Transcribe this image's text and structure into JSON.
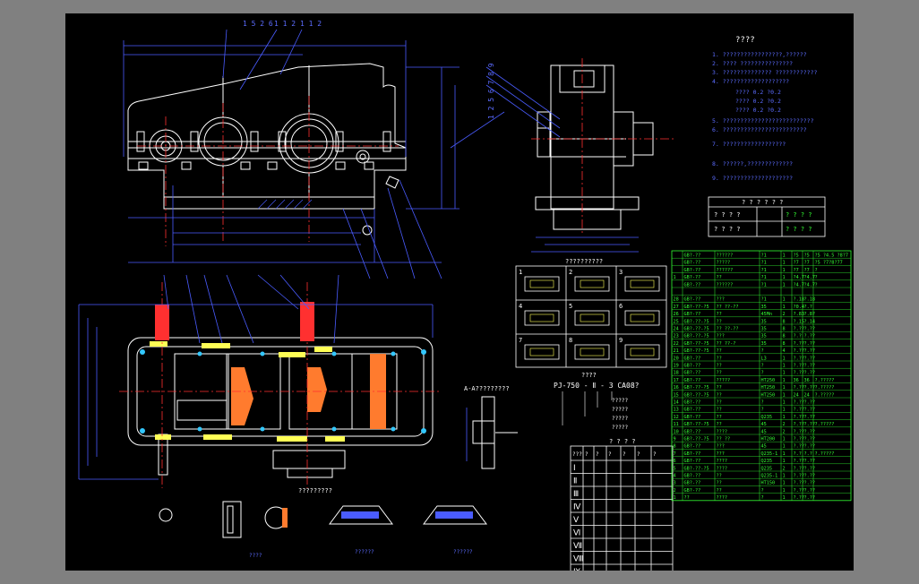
{
  "colors": {
    "background": "#808080",
    "sheet": "#000000",
    "line": "#ffffff",
    "dimension": "#4a5cff",
    "centerline": "#ff3030",
    "table": "#33ff33",
    "callout": "#5c6cff",
    "accent": "#ffff55"
  },
  "top_view_callouts": [
    "1 5 2 6",
    "1 1 2",
    "1 1 2"
  ],
  "side_callouts_vertical": "1 2 5 6 7 8 9",
  "tech_req": {
    "title": "????",
    "lines": [
      "1. ?????????????????,??????",
      "2. ???? ???????????????",
      "3. ?????????????? ????????????",
      "4. ???????????????????",
      "???? 0.2 ?0.2",
      "???? 0.2 ?0.2",
      "???? 0.2 ?0.2",
      "5. ??????????????????????????",
      "6. ????????????????????????",
      "7. ??????????????????",
      "8. ??????,?????????????",
      "9. ????????????????????"
    ]
  },
  "small_table": {
    "header": "? ? ? ? ? ?",
    "rows": [
      [
        "? ? ? ?",
        "",
        "? ? ? ?"
      ],
      [
        "? ? ? ?",
        "",
        "? ? ? ?"
      ]
    ]
  },
  "detail_grid": {
    "title": "??????????",
    "cells": [
      "1",
      "2",
      "3",
      "4",
      "5",
      "6",
      "7",
      "8",
      "9"
    ]
  },
  "model_code": {
    "caption": "????",
    "code": "PJ-750 - Ⅱ - 3 CA08?",
    "notes": [
      "?????",
      "?????",
      "?????",
      "?????"
    ]
  },
  "section_label": "A-A?????????",
  "bottom_labels": [
    "?????????",
    "????",
    "??????",
    "??????"
  ],
  "gear_table": {
    "title": "? ? ? ?",
    "roman": [
      "Ⅰ",
      "Ⅱ",
      "Ⅲ",
      "Ⅳ",
      "Ⅴ",
      "Ⅵ",
      "Ⅶ",
      "Ⅷ",
      "Ⅸ"
    ],
    "header": [
      "???",
      "?",
      "?",
      "?",
      "?",
      "?",
      "?"
    ]
  },
  "parts_list": {
    "rows": [
      [
        "",
        "GB?-??",
        "??????",
        "?1",
        "1",
        "?5",
        "?5",
        "?5 ?4.5 ?8?7"
      ],
      [
        "",
        "GB?-??",
        "?????",
        "?1",
        "1",
        "?7",
        "?7",
        "?5 ?7?8?77"
      ],
      [
        "",
        "GB?-??",
        "??????",
        "?1",
        "1",
        "?7",
        "?7",
        "?"
      ],
      [
        "1",
        "GB?-??",
        "??",
        "?1",
        "1",
        "?4.7",
        "?4.7",
        "?"
      ],
      [
        "",
        "GB?-??",
        "??????",
        "?1",
        "1",
        "?4.7",
        "?4.7",
        "?"
      ],
      [
        "",
        "",
        "",
        "",
        "",
        "",
        "",
        ""
      ],
      [
        "28",
        "GB?-??",
        "???",
        "?1",
        "1",
        "?.18",
        "?.18",
        ""
      ],
      [
        "27",
        "GB?-??-?5",
        "?? ??-??",
        "35",
        "1",
        "?0.4",
        "?.?",
        ""
      ],
      [
        "26",
        "GB?-??",
        "??",
        "45Mn",
        "2",
        "?.83",
        "?.8?",
        ""
      ],
      [
        "25",
        "GB?-??-?5",
        "??",
        "35",
        "8",
        "?.15",
        "?.14",
        ""
      ],
      [
        "24",
        "GB?-??-?5",
        "?? ??-??",
        "35",
        "8",
        "?.??",
        "?.??",
        ""
      ],
      [
        "23",
        "GB?-??-?5",
        "???",
        "35",
        "8",
        "?.?",
        "?.??",
        ""
      ],
      [
        "22",
        "GB?-??-?5",
        "?? ??-?",
        "35",
        "8",
        "?.??",
        "?.??",
        ""
      ],
      [
        "21",
        "GB?-??-?5",
        "??",
        "?",
        "4",
        "?.??",
        "?.??",
        ""
      ],
      [
        "20",
        "GB?-??",
        "??",
        "L3",
        "1",
        "?.??",
        "?.??",
        ""
      ],
      [
        "19",
        "GB?-??",
        "??",
        "?",
        "1",
        "?.??",
        "?.??",
        ""
      ],
      [
        "18",
        "GB?-??",
        "??",
        "?",
        "1",
        "?.??",
        "?.??",
        ""
      ],
      [
        "17",
        "GB?-??",
        "?????",
        "HT250",
        "1",
        "36",
        "36",
        "?.?????"
      ],
      [
        "16",
        "GB?-??-?5",
        "??",
        "HT250",
        "1",
        "?.??",
        "?.??",
        "?.?????"
      ],
      [
        "15",
        "GB?-??-?5",
        "??",
        "HT250",
        "1",
        "24",
        "24",
        "?.?????"
      ],
      [
        "14",
        "GB?-??",
        "??",
        "?",
        "1",
        "?.??",
        "?.??",
        ""
      ],
      [
        "13",
        "GB?-??",
        "??",
        "?",
        "1",
        "?.??",
        "?.??",
        ""
      ],
      [
        "12",
        "GB?-??",
        "??",
        "Q235",
        "1",
        "?.??",
        "?.??",
        ""
      ],
      [
        "11",
        "GB?-??-?5",
        "??",
        "45",
        "2",
        "?.??",
        "?.??",
        "?.?????"
      ],
      [
        "10",
        "GB?-??",
        "????",
        "45",
        "2",
        "?.??",
        "?.??",
        ""
      ],
      [
        "9",
        "GB?-??-?5",
        "?? ??",
        "HT200",
        "1",
        "?.??",
        "?.??",
        ""
      ],
      [
        "8",
        "GB?-??",
        "???",
        "45",
        "1",
        "?.??",
        "?.??",
        ""
      ],
      [
        "7",
        "GB?-??",
        "???",
        "Q235-1",
        "1",
        "?.?",
        "?.?",
        "?.?????"
      ],
      [
        "6",
        "GB?-??",
        "????",
        "Q235",
        "1",
        "?.??",
        "?.??",
        ""
      ],
      [
        "5",
        "GB?-??-?5",
        "????",
        "Q235",
        "2",
        "?.??",
        "?.??",
        ""
      ],
      [
        "4",
        "GB?-??",
        "??",
        "Q235-1",
        "1",
        "?.??",
        "?.??",
        ""
      ],
      [
        "3",
        "GB?-??",
        "??",
        "HT150",
        "1",
        "?.??",
        "?.??",
        ""
      ],
      [
        "2",
        "GB?-??",
        "??",
        "?",
        "1",
        "?.??",
        "?.??",
        ""
      ],
      [
        "1",
        "??",
        "????",
        "?",
        "1",
        "?.??",
        "?.??",
        ""
      ]
    ]
  }
}
